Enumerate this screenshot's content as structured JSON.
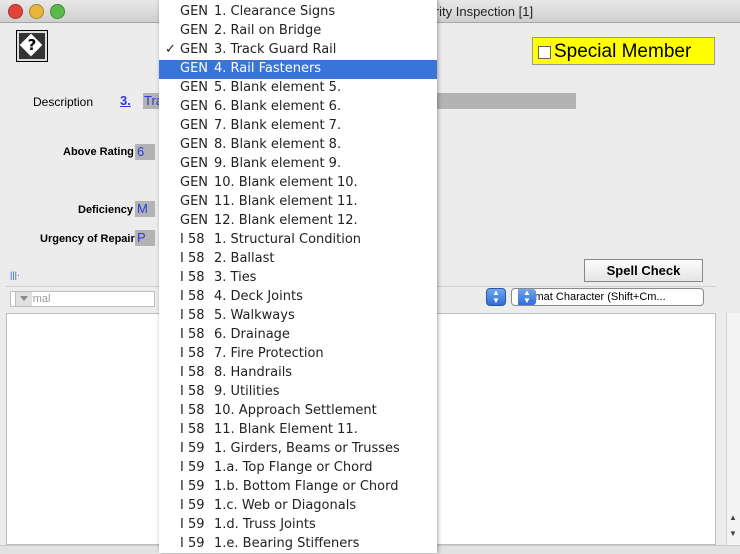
{
  "window": {
    "title": "...sportation Authority Inspection [1]"
  },
  "help": {
    "label": "?"
  },
  "special_member": {
    "label": "Special Member",
    "checked": false
  },
  "form": {
    "description_label": "Description",
    "description_number": "3.",
    "description_value": "Tra",
    "above_rating_label": "Above Rating",
    "above_rating_value": "6",
    "deficiency_label": "Deficiency",
    "deficiency_value": "M",
    "urgency_label": "Urgency of Repair",
    "urgency_value": "P"
  },
  "editor_toolbar": {
    "style_placeholder": "Normal",
    "format_select": "Format Character (Shift+Cm..."
  },
  "spell_check": {
    "label": "Spell Check"
  },
  "menu": {
    "items": [
      {
        "code": "GEN",
        "text": "1. Clearance Signs",
        "checked": false,
        "selected": false
      },
      {
        "code": "GEN",
        "text": "2. Rail on Bridge",
        "checked": false,
        "selected": false
      },
      {
        "code": "GEN",
        "text": "3. Track Guard Rail",
        "checked": true,
        "selected": false
      },
      {
        "code": "GEN",
        "text": "4. Rail Fasteners",
        "checked": false,
        "selected": true
      },
      {
        "code": "GEN",
        "text": "5. Blank element 5.",
        "checked": false,
        "selected": false
      },
      {
        "code": "GEN",
        "text": "6. Blank element 6.",
        "checked": false,
        "selected": false
      },
      {
        "code": "GEN",
        "text": "7. Blank element 7.",
        "checked": false,
        "selected": false
      },
      {
        "code": "GEN",
        "text": "8. Blank element 8.",
        "checked": false,
        "selected": false
      },
      {
        "code": "GEN",
        "text": "9. Blank element 9.",
        "checked": false,
        "selected": false
      },
      {
        "code": "GEN",
        "text": "10. Blank element 10.",
        "checked": false,
        "selected": false
      },
      {
        "code": "GEN",
        "text": "11. Blank element 11.",
        "checked": false,
        "selected": false
      },
      {
        "code": "GEN",
        "text": "12. Blank element 12.",
        "checked": false,
        "selected": false
      },
      {
        "code": "I 58",
        "text": "1. Structural Condition",
        "checked": false,
        "selected": false
      },
      {
        "code": "I 58",
        "text": "2. Ballast",
        "checked": false,
        "selected": false
      },
      {
        "code": "I 58",
        "text": "3. Ties",
        "checked": false,
        "selected": false
      },
      {
        "code": "I 58",
        "text": "4. Deck Joints",
        "checked": false,
        "selected": false
      },
      {
        "code": "I 58",
        "text": "5. Walkways",
        "checked": false,
        "selected": false
      },
      {
        "code": "I 58",
        "text": "6. Drainage",
        "checked": false,
        "selected": false
      },
      {
        "code": "I 58",
        "text": "7. Fire Protection",
        "checked": false,
        "selected": false
      },
      {
        "code": "I 58",
        "text": "8. Handrails",
        "checked": false,
        "selected": false
      },
      {
        "code": "I 58",
        "text": "9. Utilities",
        "checked": false,
        "selected": false
      },
      {
        "code": "I 58",
        "text": "10. Approach Settlement",
        "checked": false,
        "selected": false
      },
      {
        "code": "I 58",
        "text": "11. Blank Element 11.",
        "checked": false,
        "selected": false
      },
      {
        "code": "I 59",
        "text": "1. Girders, Beams or Trusses",
        "checked": false,
        "selected": false
      },
      {
        "code": "I 59",
        "text": "1.a. Top Flange or Chord",
        "checked": false,
        "selected": false
      },
      {
        "code": "I 59",
        "text": "1.b. Bottom Flange or Chord",
        "checked": false,
        "selected": false
      },
      {
        "code": "I 59",
        "text": "1.c. Web or Diagonals",
        "checked": false,
        "selected": false
      },
      {
        "code": "I 59",
        "text": "1.d. Truss Joints",
        "checked": false,
        "selected": false
      },
      {
        "code": "I 59",
        "text": "1.e. Bearing Stiffeners",
        "checked": false,
        "selected": false
      }
    ]
  },
  "colors": {
    "selection": "#3875d7",
    "special_bg": "#ffff00",
    "link": "#2a3bd6"
  }
}
